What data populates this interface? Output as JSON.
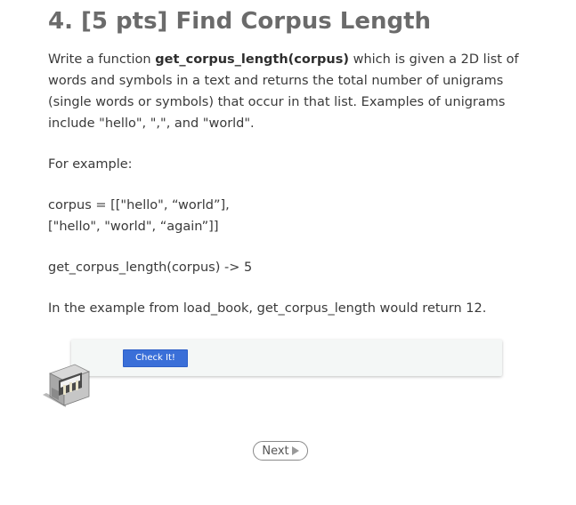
{
  "question": {
    "title": "4. [5 pts] Find Corpus Length",
    "intro_before": "Write a function ",
    "function_name": "get_corpus_length(corpus)",
    "intro_after": " which is given a 2D list of words and symbols in a text and returns the total number of unigrams (single words or symbols) that occur in that list. Examples of unigrams include \"hello\", \",\", and \"world\".",
    "example_label": "For example:",
    "corpus_line_1": "corpus = [[\"hello\", “world”],",
    "corpus_line_2": "[\"hello\", \"world\", “again”]]",
    "call_line": "get_corpus_length(corpus) -> 5",
    "closing_note": "In the example from load_book, get_corpus_length would return 12."
  },
  "checker": {
    "button_label": "Check It!",
    "icon": "robot-icon"
  },
  "navigation": {
    "next_label": "Next",
    "next_icon": "play-arrow-icon"
  },
  "colors": {
    "title": "#6b6b6b",
    "button": "#3a6fd8",
    "panel": "#f4f7f6"
  }
}
